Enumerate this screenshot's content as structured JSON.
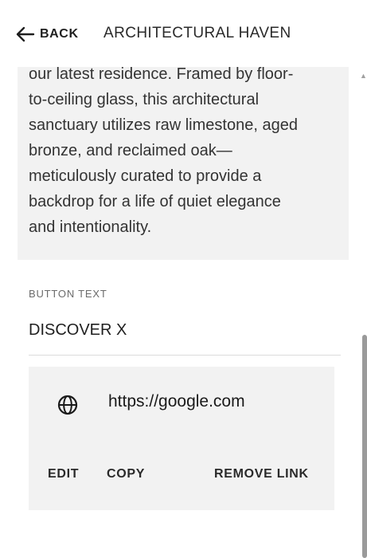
{
  "header": {
    "back_label": "BACK",
    "title": "ARCHITECTURAL HAVEN"
  },
  "description": {
    "text": "our latest residence. Framed by floor-\nto-ceiling glass, this architectural\nsanctuary utilizes raw limestone, aged\nbronze, and reclaimed oak—\nmeticulously curated to provide a\nbackdrop for a life of quiet elegance\nand intentionality."
  },
  "button_text_field": {
    "label": "BUTTON TEXT",
    "value": "DISCOVER X"
  },
  "link_card": {
    "icon": "globe-icon",
    "url": "https://google.com",
    "actions": {
      "edit": "EDIT",
      "copy": "COPY",
      "remove": "REMOVE LINK"
    }
  }
}
